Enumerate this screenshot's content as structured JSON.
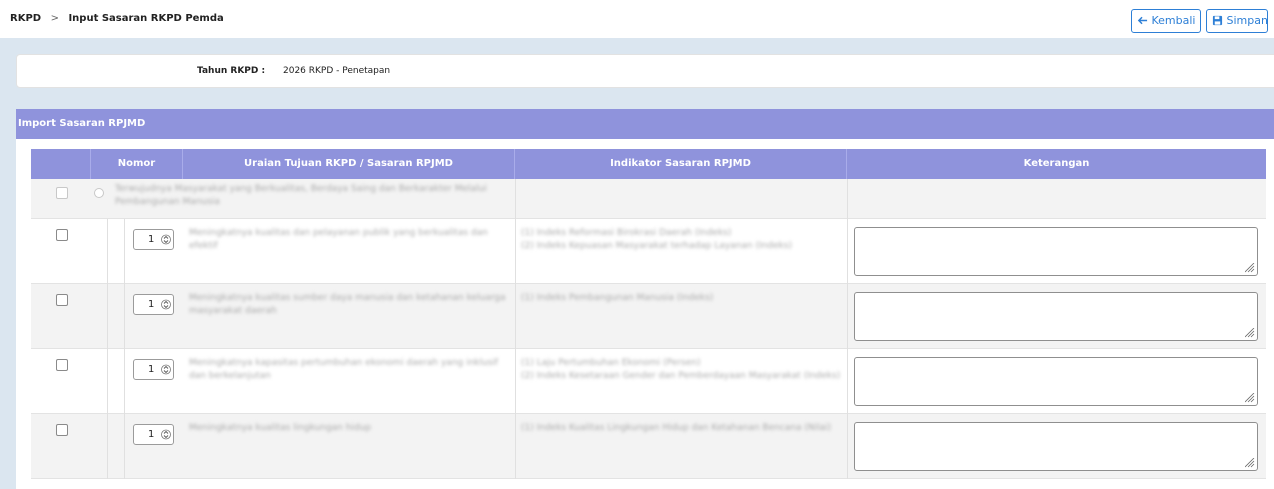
{
  "breadcrumb": {
    "root": "RKPD",
    "separator": ">",
    "current": "Input Sasaran RKPD Pemda"
  },
  "toolbar": {
    "back_label": "Kembali",
    "back_icon": "arrow-left-icon",
    "save_label": "Simpan",
    "save_icon": "floppy-disk-icon"
  },
  "year": {
    "label": "Tahun RKPD :",
    "value": "2026 RKPD - Penetapan"
  },
  "import_panel": {
    "title": "Import Sasaran RPJMD"
  },
  "table": {
    "columns": [
      "Nomor",
      "Uraian Tujuan RKPD / Sasaran RPJMD",
      "Indikator Sasaran RPJMD",
      "Keterangan"
    ],
    "group_row": {
      "text": "Terwujudnya Masyarakat yang Berkualitas, Berdaya Saing dan Berkarakter Melalui Pembangunan Manusia"
    },
    "rows": [
      {
        "number": "1",
        "uraian": "Meningkatnya kualitas dan pelayanan publik yang berkualitas dan efektif",
        "indikator": "(1) Indeks Reformasi Birokrasi Daerah (Indeks)\n(2) Indeks Kepuasan Masyarakat terhadap Layanan (Indeks)",
        "keterangan": ""
      },
      {
        "number": "1",
        "uraian": "Meningkatnya kualitas sumber daya manusia dan ketahanan keluarga masyarakat daerah",
        "indikator": "(1) Indeks Pembangunan Manusia (Indeks)",
        "keterangan": ""
      },
      {
        "number": "1",
        "uraian": "Meningkatnya kapasitas pertumbuhan ekonomi daerah yang inklusif dan berkelanjutan",
        "indikator": "(1) Laju Pertumbuhan Ekonomi (Persen)\n(2) Indeks Kesetaraan Gender dan Pemberdayaan Masyarakat (Indeks)",
        "keterangan": ""
      },
      {
        "number": "1",
        "uraian": "Meningkatnya kualitas lingkungan hidup",
        "indikator": "(1) Indeks Kualitas Lingkungan Hidup dan Ketahanan Bencana (Nilai)",
        "keterangan": ""
      }
    ]
  }
}
